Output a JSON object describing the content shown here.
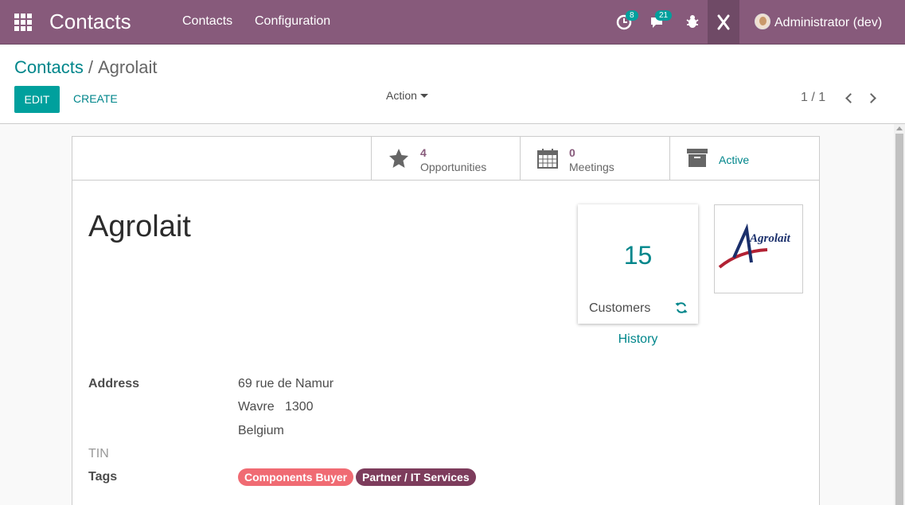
{
  "navbar": {
    "brand": "Contacts",
    "menu": [
      "Contacts",
      "Configuration"
    ],
    "activity_count": "8",
    "messages_count": "21",
    "user": "Administrator (dev)",
    "accent_color": "#875a7b"
  },
  "breadcrumb": {
    "parent": "Contacts",
    "separator": "/",
    "current": "Agrolait"
  },
  "toolbar": {
    "edit_label": "EDIT",
    "create_label": "CREATE",
    "action_label": "Action",
    "pager": "1 / 1"
  },
  "stat_buttons": [
    {
      "value": "4",
      "label": "Opportunities",
      "icon": "star-icon"
    },
    {
      "value": "0",
      "label": "Meetings",
      "icon": "calendar-icon"
    },
    {
      "label": "Active",
      "icon": "archive-icon"
    }
  ],
  "record": {
    "name": "Agrolait",
    "customers_count": "15",
    "customers_label": "Customers",
    "history_label": "History",
    "logo_text": "Agrolait"
  },
  "fields": {
    "address_label": "Address",
    "street": "69 rue de Namur",
    "city_zip": "Wavre   1300",
    "country": "Belgium",
    "tin_label": "TIN",
    "tags_label": "Tags",
    "tags": [
      {
        "name": "Components Buyer",
        "color": "#f06b73"
      },
      {
        "name": "Partner / IT Services",
        "color": "#7d3c5c"
      }
    ]
  }
}
